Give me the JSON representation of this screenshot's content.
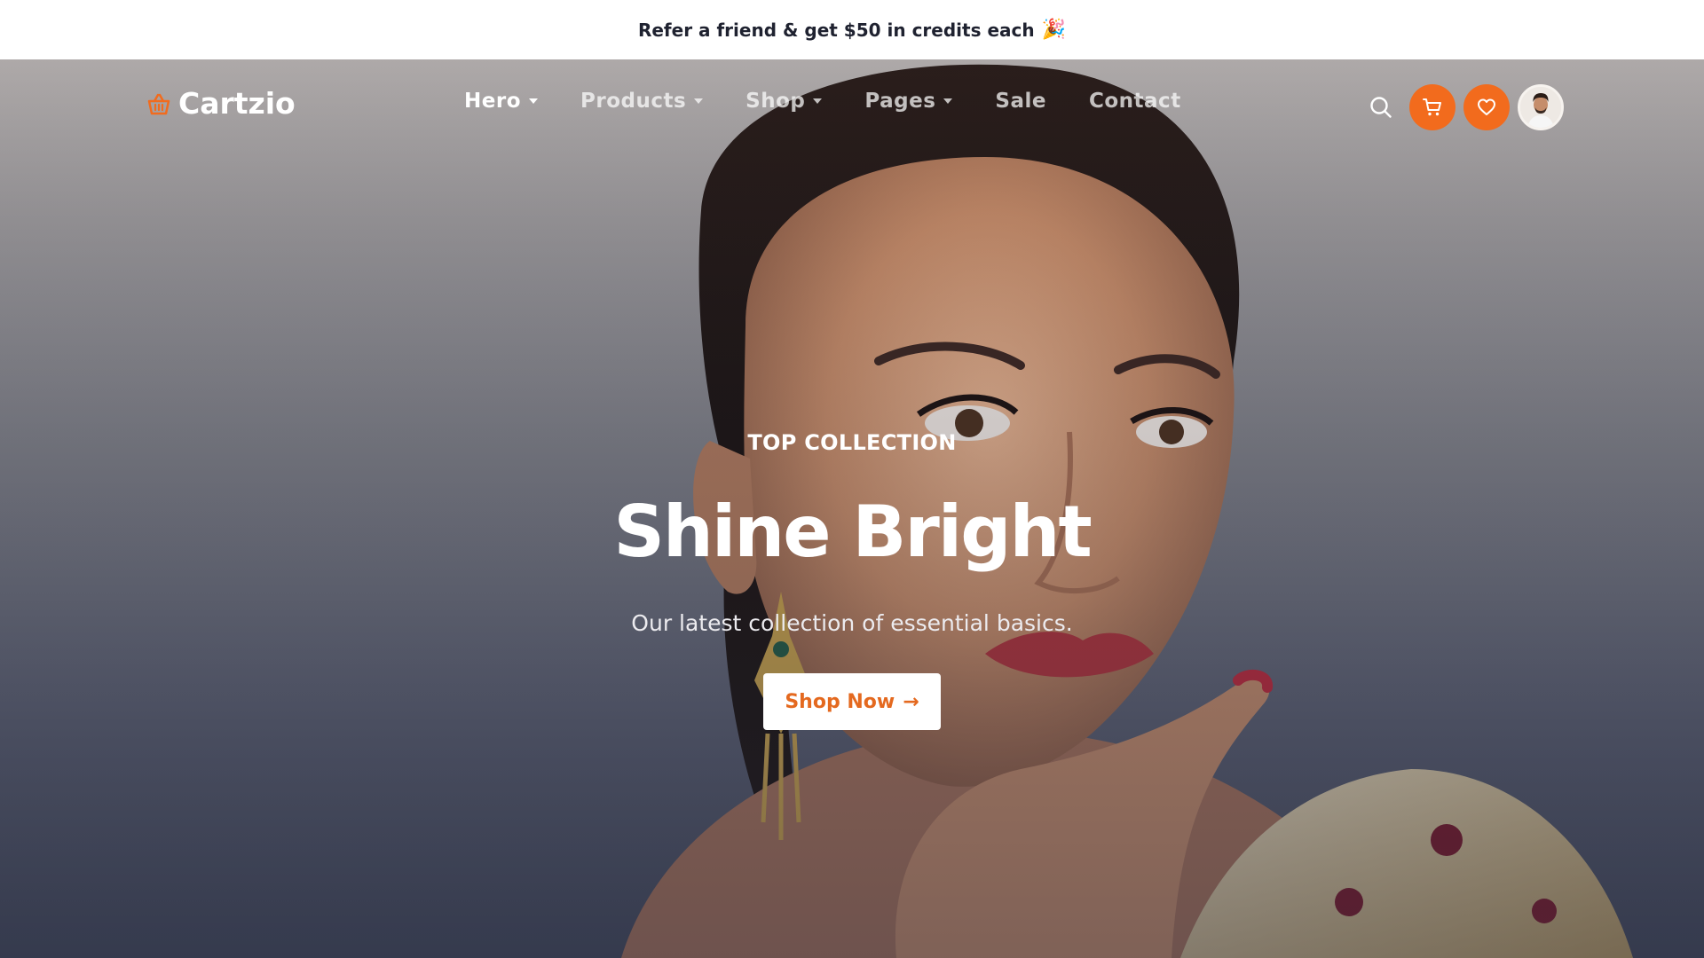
{
  "announcement": {
    "text": "Refer a friend & get $50 in credits each",
    "emoji": "🎉"
  },
  "brand": {
    "name": "Cartzio",
    "icon": "shopping-basket-icon",
    "accent": "#f26b1d"
  },
  "nav": {
    "items": [
      {
        "label": "Hero",
        "has_dropdown": true,
        "active": true
      },
      {
        "label": "Products",
        "has_dropdown": true,
        "active": false
      },
      {
        "label": "Shop",
        "has_dropdown": true,
        "active": false
      },
      {
        "label": "Pages",
        "has_dropdown": true,
        "active": false
      },
      {
        "label": "Sale",
        "has_dropdown": false,
        "active": false
      },
      {
        "label": "Contact",
        "has_dropdown": false,
        "active": false
      }
    ]
  },
  "actions": {
    "search_icon": "search-icon",
    "cart_icon": "cart-icon",
    "wishlist_icon": "heart-icon",
    "avatar": "user-avatar"
  },
  "hero": {
    "eyebrow": "TOP COLLECTION",
    "headline": "Shine Bright",
    "subhead": "Our latest collection of essential basics.",
    "cta_label": "Shop Now",
    "cta_icon": "arrow-right-icon",
    "background": "portrait-photo"
  }
}
